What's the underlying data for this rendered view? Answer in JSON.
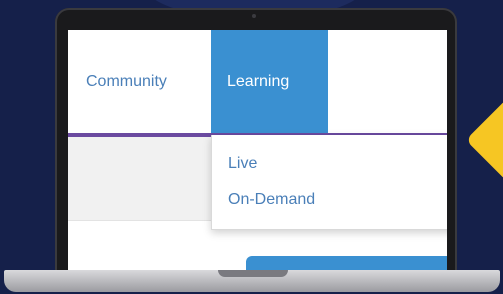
{
  "nav": {
    "items": [
      {
        "label": "Community"
      },
      {
        "label": "Learning",
        "active": true
      }
    ]
  },
  "dropdown": {
    "items": [
      {
        "label": "Live"
      },
      {
        "label": "On-Demand"
      }
    ]
  },
  "colors": {
    "background": "#15204a",
    "accent_blue": "#3a90d1",
    "link_blue": "#4a7fb8",
    "nav_underline": "#6b4aa0",
    "accent_yellow": "#f6c623"
  }
}
